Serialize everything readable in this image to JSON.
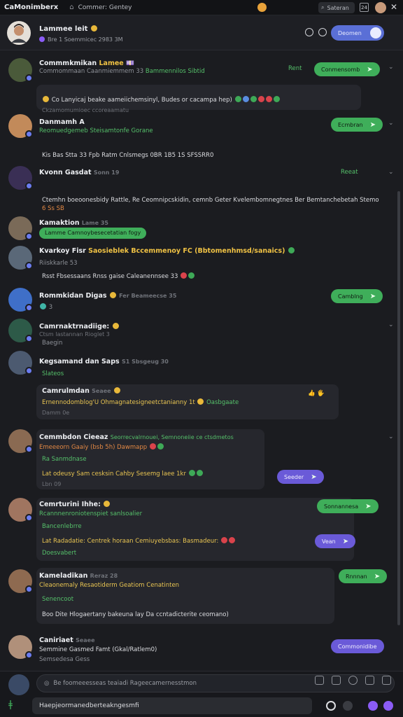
{
  "titlebar": {
    "app_title": "CaMonimberx",
    "tab_title": "Commer: Gentey",
    "search_label": "Sateran",
    "box_label": "24",
    "close": "✕"
  },
  "header": {
    "name": "Lammee leit",
    "subtitle": "Bre 1 Soemmicec 2983 3M",
    "button_label": "Deomen"
  },
  "messages": [
    {
      "name": "Commmkmikan",
      "name_hl": "Lamee 💷",
      "line1": "Commommaan Caanmiemmem 33",
      "line2": "Bammennilos Sibtid",
      "line3": "Co Lanyicaj beake aameiichemsinyl, Budes or cacampa hep)",
      "time": "Ckzamomumioec ccoreaamatu",
      "pill": "Conmensomb",
      "side": "Rent"
    },
    {
      "name": "Danmamh A",
      "sub": "Reomuedgemeb Steisamtonfe Gorane",
      "line1": "Kis Bas Stta 33 Fpb Ratm Cnlsmegs 0BR 1B5 1S SFSSRR0",
      "pill": "Ecmbran"
    },
    {
      "name": "Kvonn Gasdat",
      "sub": "Sonn 19",
      "time": "Reeat",
      "line1": "Ctemhn boeoonesbidy Rattle, Re Ceomnipcskidin, cemnb Geter Kvelembomnegtnes Ber Bemtanchebetah Stemo",
      "line2": "6 Ss SB"
    },
    {
      "name": "Kamaktion",
      "sub": "Lame 35",
      "pill": "Lamme Camnoybesecetatian fogy"
    },
    {
      "name": "Kvarkoy Fisr",
      "hl": "Saosieblek Bccemmenoy FC (Bbtomenhmsd/sanaics)",
      "line1": "Riiskkarle 53",
      "line2": "Rsst Fbsessaans Rnss gaise Caleanennsee 33"
    },
    {
      "name": "Rommkidan Digas",
      "sub": "Fer Beameecse 35",
      "pill": "Camblng"
    },
    {
      "name": "Camrnaktrnadiige:",
      "sub": "Ctsm lastannan Rioglet 3",
      "line1": "Baegin"
    },
    {
      "name": "Kegsamand dan Saps",
      "sub": "S1 Sbsgeug 30",
      "line1": "Slateos"
    },
    {
      "name": "Camrulmdan",
      "sub": "Seaee",
      "line1": "Ernennodomblog'U Ohmagnatesigneetctanianny 1t",
      "line1_hl": "Oasbgaate",
      "time": "Damm 0e",
      "pill": "👍 🖐"
    },
    {
      "name": "Cemmbdon Cieeaz",
      "hl": "Seorrecvalrnouei, Semnoneiie ce ctsdmetos",
      "sub": "Emeeeorn Gaaiy (bsb 5h) Dawmapp",
      "line1": "Ra Sanmdnase",
      "line2": "Lat odeusy Sam cesksin Cahby Sesemg laee 1kr",
      "time": "Lbn 09",
      "pill": "Seeder"
    },
    {
      "name": "Cemrturini Ihhe:",
      "sub": "Rcannnenroniotenspiet sanlsoalier",
      "line1": "Bancenlebrre",
      "line2": "Lat Radadatie: Centrek horaan Cemiuyebsbas: Basmadeur:",
      "line3": "Doesvabert",
      "pill": "Sonnannesa",
      "pill2": "Vean"
    },
    {
      "name": "Kameladikan",
      "sub": "Reraz 28",
      "line1": "Cleaonemaly Resaotiderm Geatiom Cenatinten",
      "line2": "Senencoot",
      "line3": "Boo Dite Hlogaertany bakeuna lay Da ccntadicterite ceomano)",
      "pill": "Rnnnan"
    },
    {
      "name": "Caniriaet",
      "sub": "Seaee",
      "line1": "Semmine Gasmed Famt (Gkal/Ratlem0)",
      "line2": "Semsedesa Gess",
      "pill": "Commonidibe"
    }
  ],
  "composer": {
    "reply_placeholder": "Be foomeeesseas teaiadi Rageecamernesstmon",
    "input_value": "Haepjeormanedberteakngesmfi"
  }
}
